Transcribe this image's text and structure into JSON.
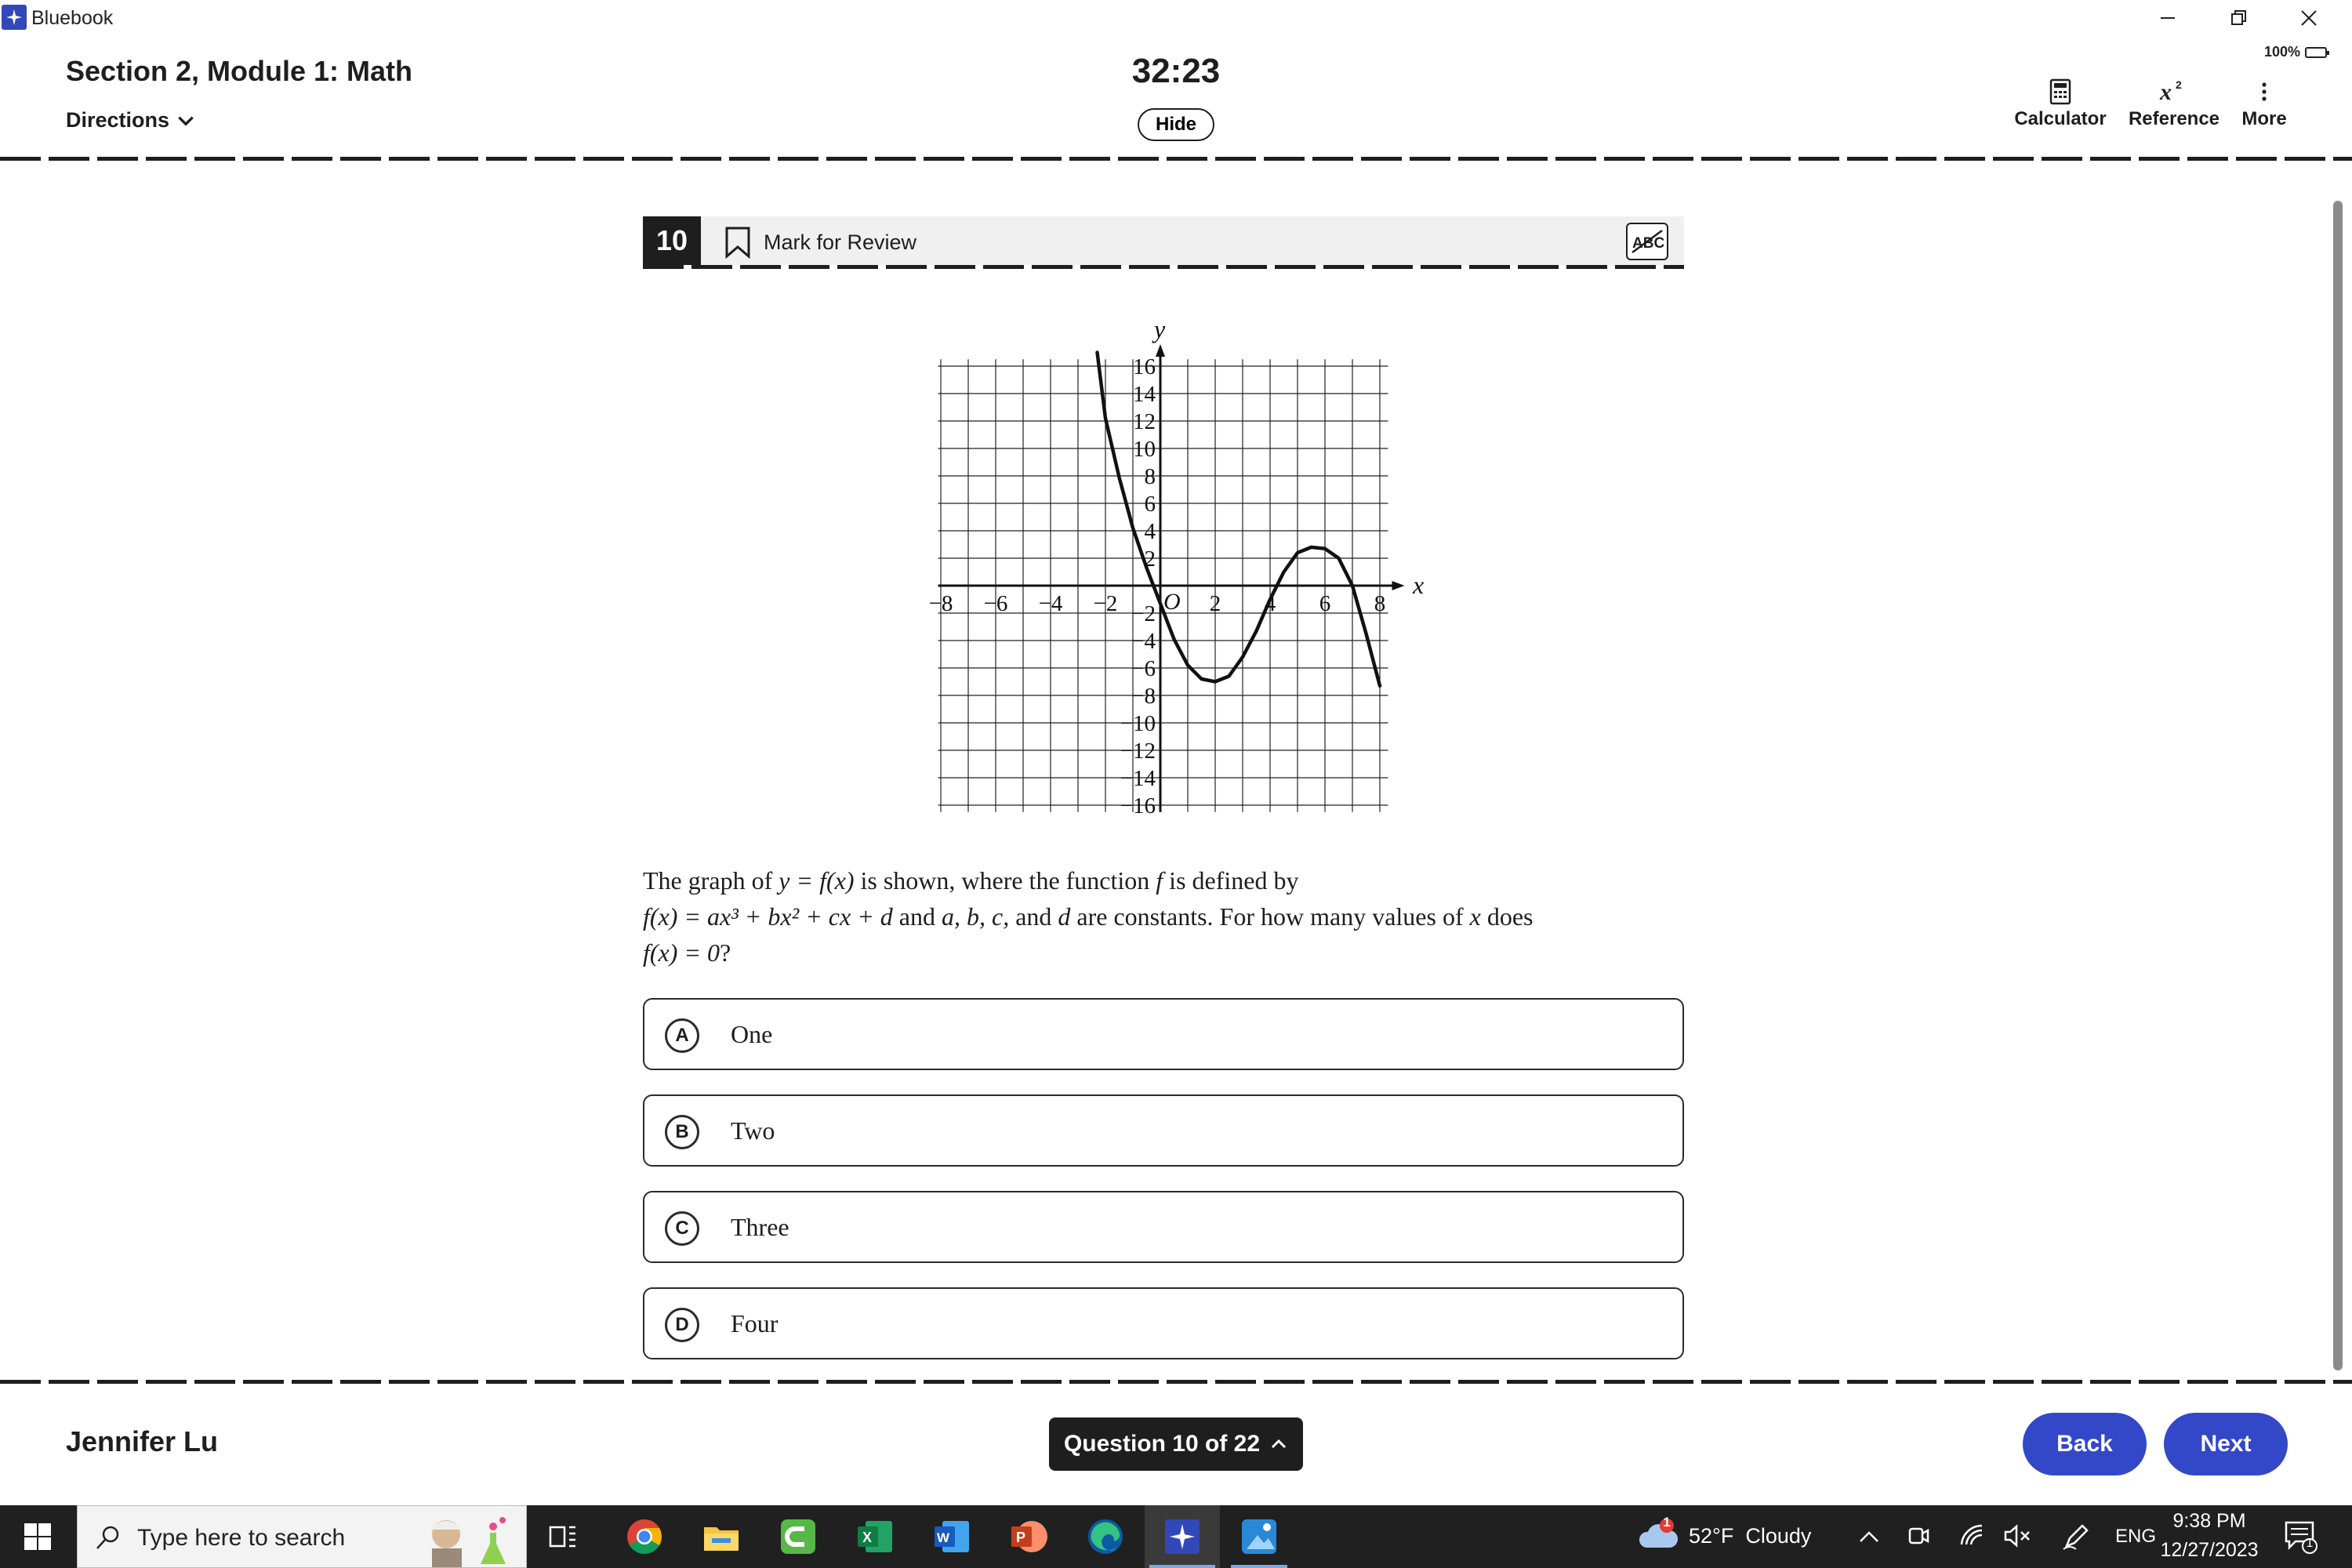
{
  "window": {
    "app_name": "Bluebook",
    "battery_text": "100%"
  },
  "header": {
    "section_title": "Section 2, Module 1: Math",
    "directions_label": "Directions",
    "timer": "32:23",
    "hide_label": "Hide",
    "tools": {
      "calculator": "Calculator",
      "reference": "Reference",
      "more": "More"
    }
  },
  "question": {
    "number": "10",
    "mark_for_review": "Mark for Review",
    "text_line1_prefix": "The graph of",
    "text_line1_eq": "y = f(x)",
    "text_line1_mid": "is shown, where the function",
    "text_line1_f": "f",
    "text_line1_suffix": "is defined by",
    "text_line2_eq": "f(x) = ax³ + bx² + cx + d",
    "text_line2_and": "and",
    "text_line2_consts": "a, b, c,",
    "text_line2_and2": "and",
    "text_line2_d": "d",
    "text_line2_suffix": "are constants. For how many values of",
    "text_line2_x": "x",
    "text_line2_does": "does",
    "text_line3_eq": "f(x) = 0",
    "text_line3_q": "?",
    "choices": [
      {
        "letter": "A",
        "text": "One"
      },
      {
        "letter": "B",
        "text": "Two"
      },
      {
        "letter": "C",
        "text": "Three"
      },
      {
        "letter": "D",
        "text": "Four"
      }
    ]
  },
  "chart_data": {
    "type": "line",
    "xlabel": "x",
    "ylabel": "y",
    "origin_label": "O",
    "xlim": [
      -8,
      8
    ],
    "ylim": [
      -16,
      16
    ],
    "x_ticks": [
      -8,
      -6,
      -4,
      -2,
      2,
      4,
      6,
      8
    ],
    "y_ticks": [
      16,
      14,
      12,
      10,
      8,
      6,
      4,
      2,
      -2,
      -4,
      -6,
      -8,
      -10,
      -12,
      -14,
      -16
    ],
    "grid": true,
    "series": [
      {
        "x": [
          -2.3,
          -2,
          -1.5,
          -1,
          -0.5,
          0,
          0.5,
          1,
          1.5,
          2,
          2.5,
          3,
          3.5,
          4,
          4.5,
          5,
          5.5,
          6,
          6.5,
          7,
          7.5,
          8
        ],
        "y": [
          17,
          12.2,
          7.9,
          4.2,
          1.3,
          -1.3,
          -3.9,
          -5.8,
          -6.8,
          -7,
          -6.6,
          -5.2,
          -3.3,
          -1,
          1,
          2.4,
          2.8,
          2.7,
          2,
          0,
          -3.5,
          -7.3
        ]
      }
    ]
  },
  "footer": {
    "student_name": "Jennifer Lu",
    "question_nav": "Question 10 of 22",
    "back_label": "Back",
    "next_label": "Next"
  },
  "taskbar": {
    "search_placeholder": "Type here to search",
    "weather": "52°F  Cloudy",
    "weather_badge": "1",
    "language": "ENG",
    "time": "9:38 PM",
    "date": "12/27/2023",
    "notification_count": "1"
  }
}
